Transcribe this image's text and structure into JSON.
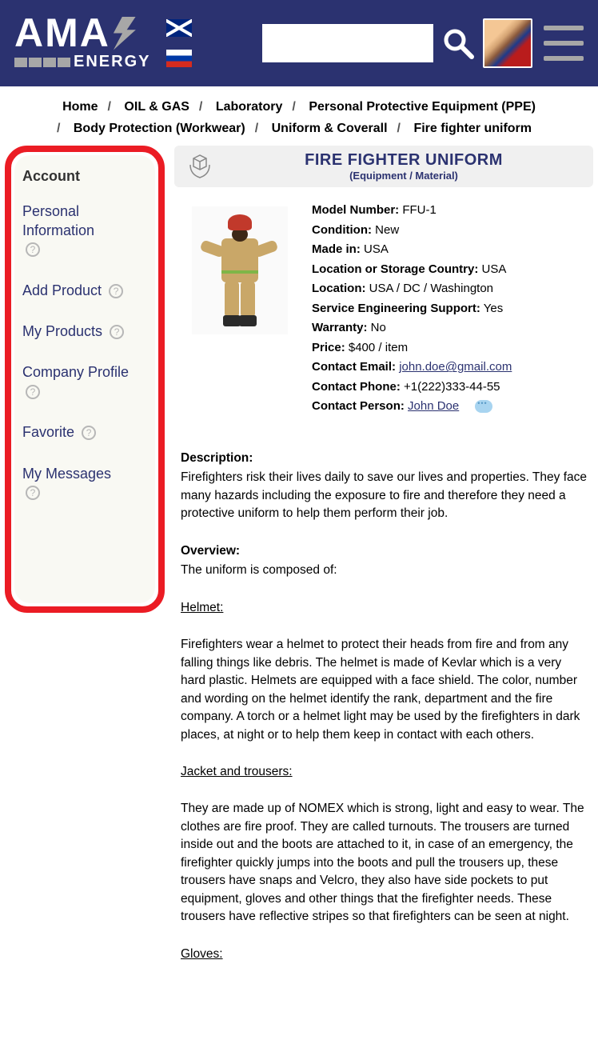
{
  "logo": {
    "brand": "AMA",
    "sub": "ENERGY"
  },
  "breadcrumbs": [
    "Home",
    "OIL & GAS",
    "Laboratory",
    "Personal Protective Equipment (PPE)",
    "Body Protection (Workwear)",
    "Uniform & Coverall",
    "Fire fighter uniform"
  ],
  "sidebar": {
    "title": "Account",
    "items": [
      {
        "label": "Personal Information"
      },
      {
        "label": "Add Product"
      },
      {
        "label": "My Products"
      },
      {
        "label": "Company Profile"
      },
      {
        "label": "Favorite"
      },
      {
        "label": "My Messages"
      }
    ]
  },
  "page": {
    "title": "FIRE FIGHTER UNIFORM",
    "subtitle": "(Equipment / Material)"
  },
  "specs": {
    "model_label": "Model Number:",
    "model": "FFU-1",
    "condition_label": "Condition:",
    "condition": "New",
    "made_label": "Made in:",
    "made": "USA",
    "storage_label": "Location or Storage Country:",
    "storage": "USA",
    "location_label": "Location:",
    "location": "USA / DC / Washington",
    "support_label": "Service Engineering Support:",
    "support": "Yes",
    "warranty_label": "Warranty:",
    "warranty": "No",
    "price_label": "Price:",
    "price": "$400 / item",
    "email_label": "Contact Email:",
    "email": "john.doe@gmail.com",
    "phone_label": "Contact Phone:",
    "phone": "+1(222)333-44-55",
    "person_label": "Contact Person:",
    "person": "John Doe"
  },
  "desc": {
    "description_h": "Description:",
    "description_p": "Firefighters risk their lives daily to save our lives and properties. They face many hazards including the exposure to fire and therefore they need a protective uniform to help them perform their job.",
    "overview_h": "Overview:",
    "overview_p": "The uniform is composed of:",
    "helmet_h": "Helmet:",
    "helmet_p": "Firefighters wear a helmet to protect their heads from fire and from any falling things like debris. The helmet is made of Kevlar which is a very hard plastic. Helmets are equipped with a face shield. The color, number and wording on the helmet identify the rank, department and the fire company. A torch or a helmet light may be used by the firefighters in dark places, at night or to help them keep in contact with each others.",
    "jacket_h": "Jacket and trousers:",
    "jacket_p": "They are made up of NOMEX which is strong, light and easy to wear. The clothes are fire proof. They are called turnouts. The trousers are turned inside out and the boots are attached to it, in case of an emergency, the firefighter quickly jumps into the boots and pull the trousers up, these trousers have snaps and Velcro, they also have side pockets to put equipment, gloves and other things that the firefighter needs. These trousers have reflective stripes so that firefighters can be seen at night.",
    "gloves_h": "Gloves:"
  }
}
